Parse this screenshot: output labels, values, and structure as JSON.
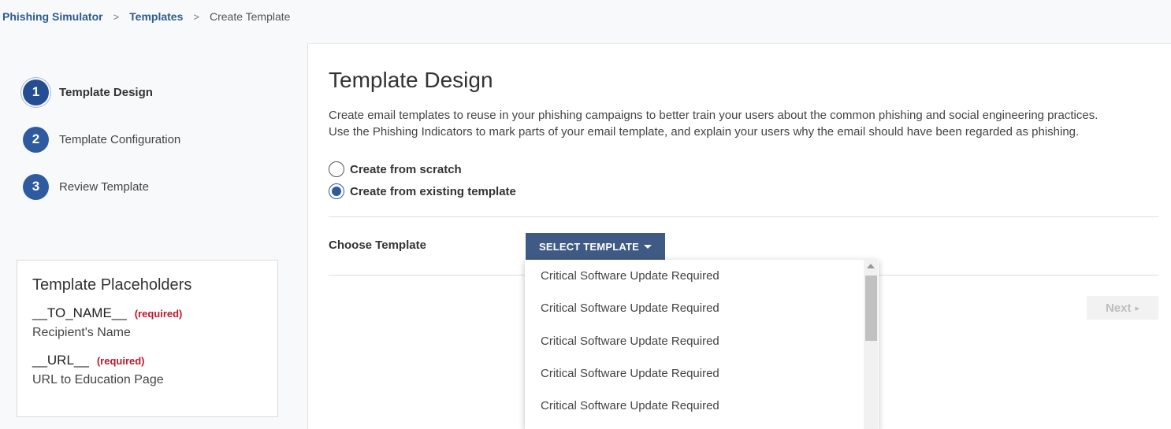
{
  "breadcrumb": {
    "items": [
      "Phishing Simulator",
      "Templates"
    ],
    "current": "Create Template",
    "separator": ">"
  },
  "steps": [
    {
      "number": "1",
      "label": "Template Design",
      "active": true
    },
    {
      "number": "2",
      "label": "Template Configuration",
      "active": false
    },
    {
      "number": "3",
      "label": "Review Template",
      "active": false
    }
  ],
  "placeholders": {
    "title": "Template Placeholders",
    "items": [
      {
        "name": "__TO_NAME__",
        "required": "(required)",
        "description": "Recipient's Name"
      },
      {
        "name": "__URL__",
        "required": "(required)",
        "description": "URL to Education Page"
      }
    ]
  },
  "main": {
    "title": "Template Design",
    "description_line1": "Create email templates to reuse in your phishing campaigns to better train your users about the common phishing and social engineering practices.",
    "description_line2": "Use the Phishing Indicators to mark parts of your email template, and explain your users why the email should have been regarded as phishing.",
    "radio_options": [
      {
        "label": "Create from scratch",
        "checked": false
      },
      {
        "label": "Create from existing template",
        "checked": true
      }
    ],
    "choose_label": "Choose Template",
    "select_button": "SELECT TEMPLATE",
    "next_button": "Next"
  },
  "dropdown": {
    "items": [
      "Critical Software Update Required",
      "Critical Software Update Required",
      "Critical Software Update Required",
      "Critical Software Update Required",
      "Critical Software Update Required"
    ]
  },
  "colors": {
    "accent": "#2e5b9f",
    "button": "#3f5a85",
    "required": "#c0162c",
    "link": "#2e5b8c"
  }
}
